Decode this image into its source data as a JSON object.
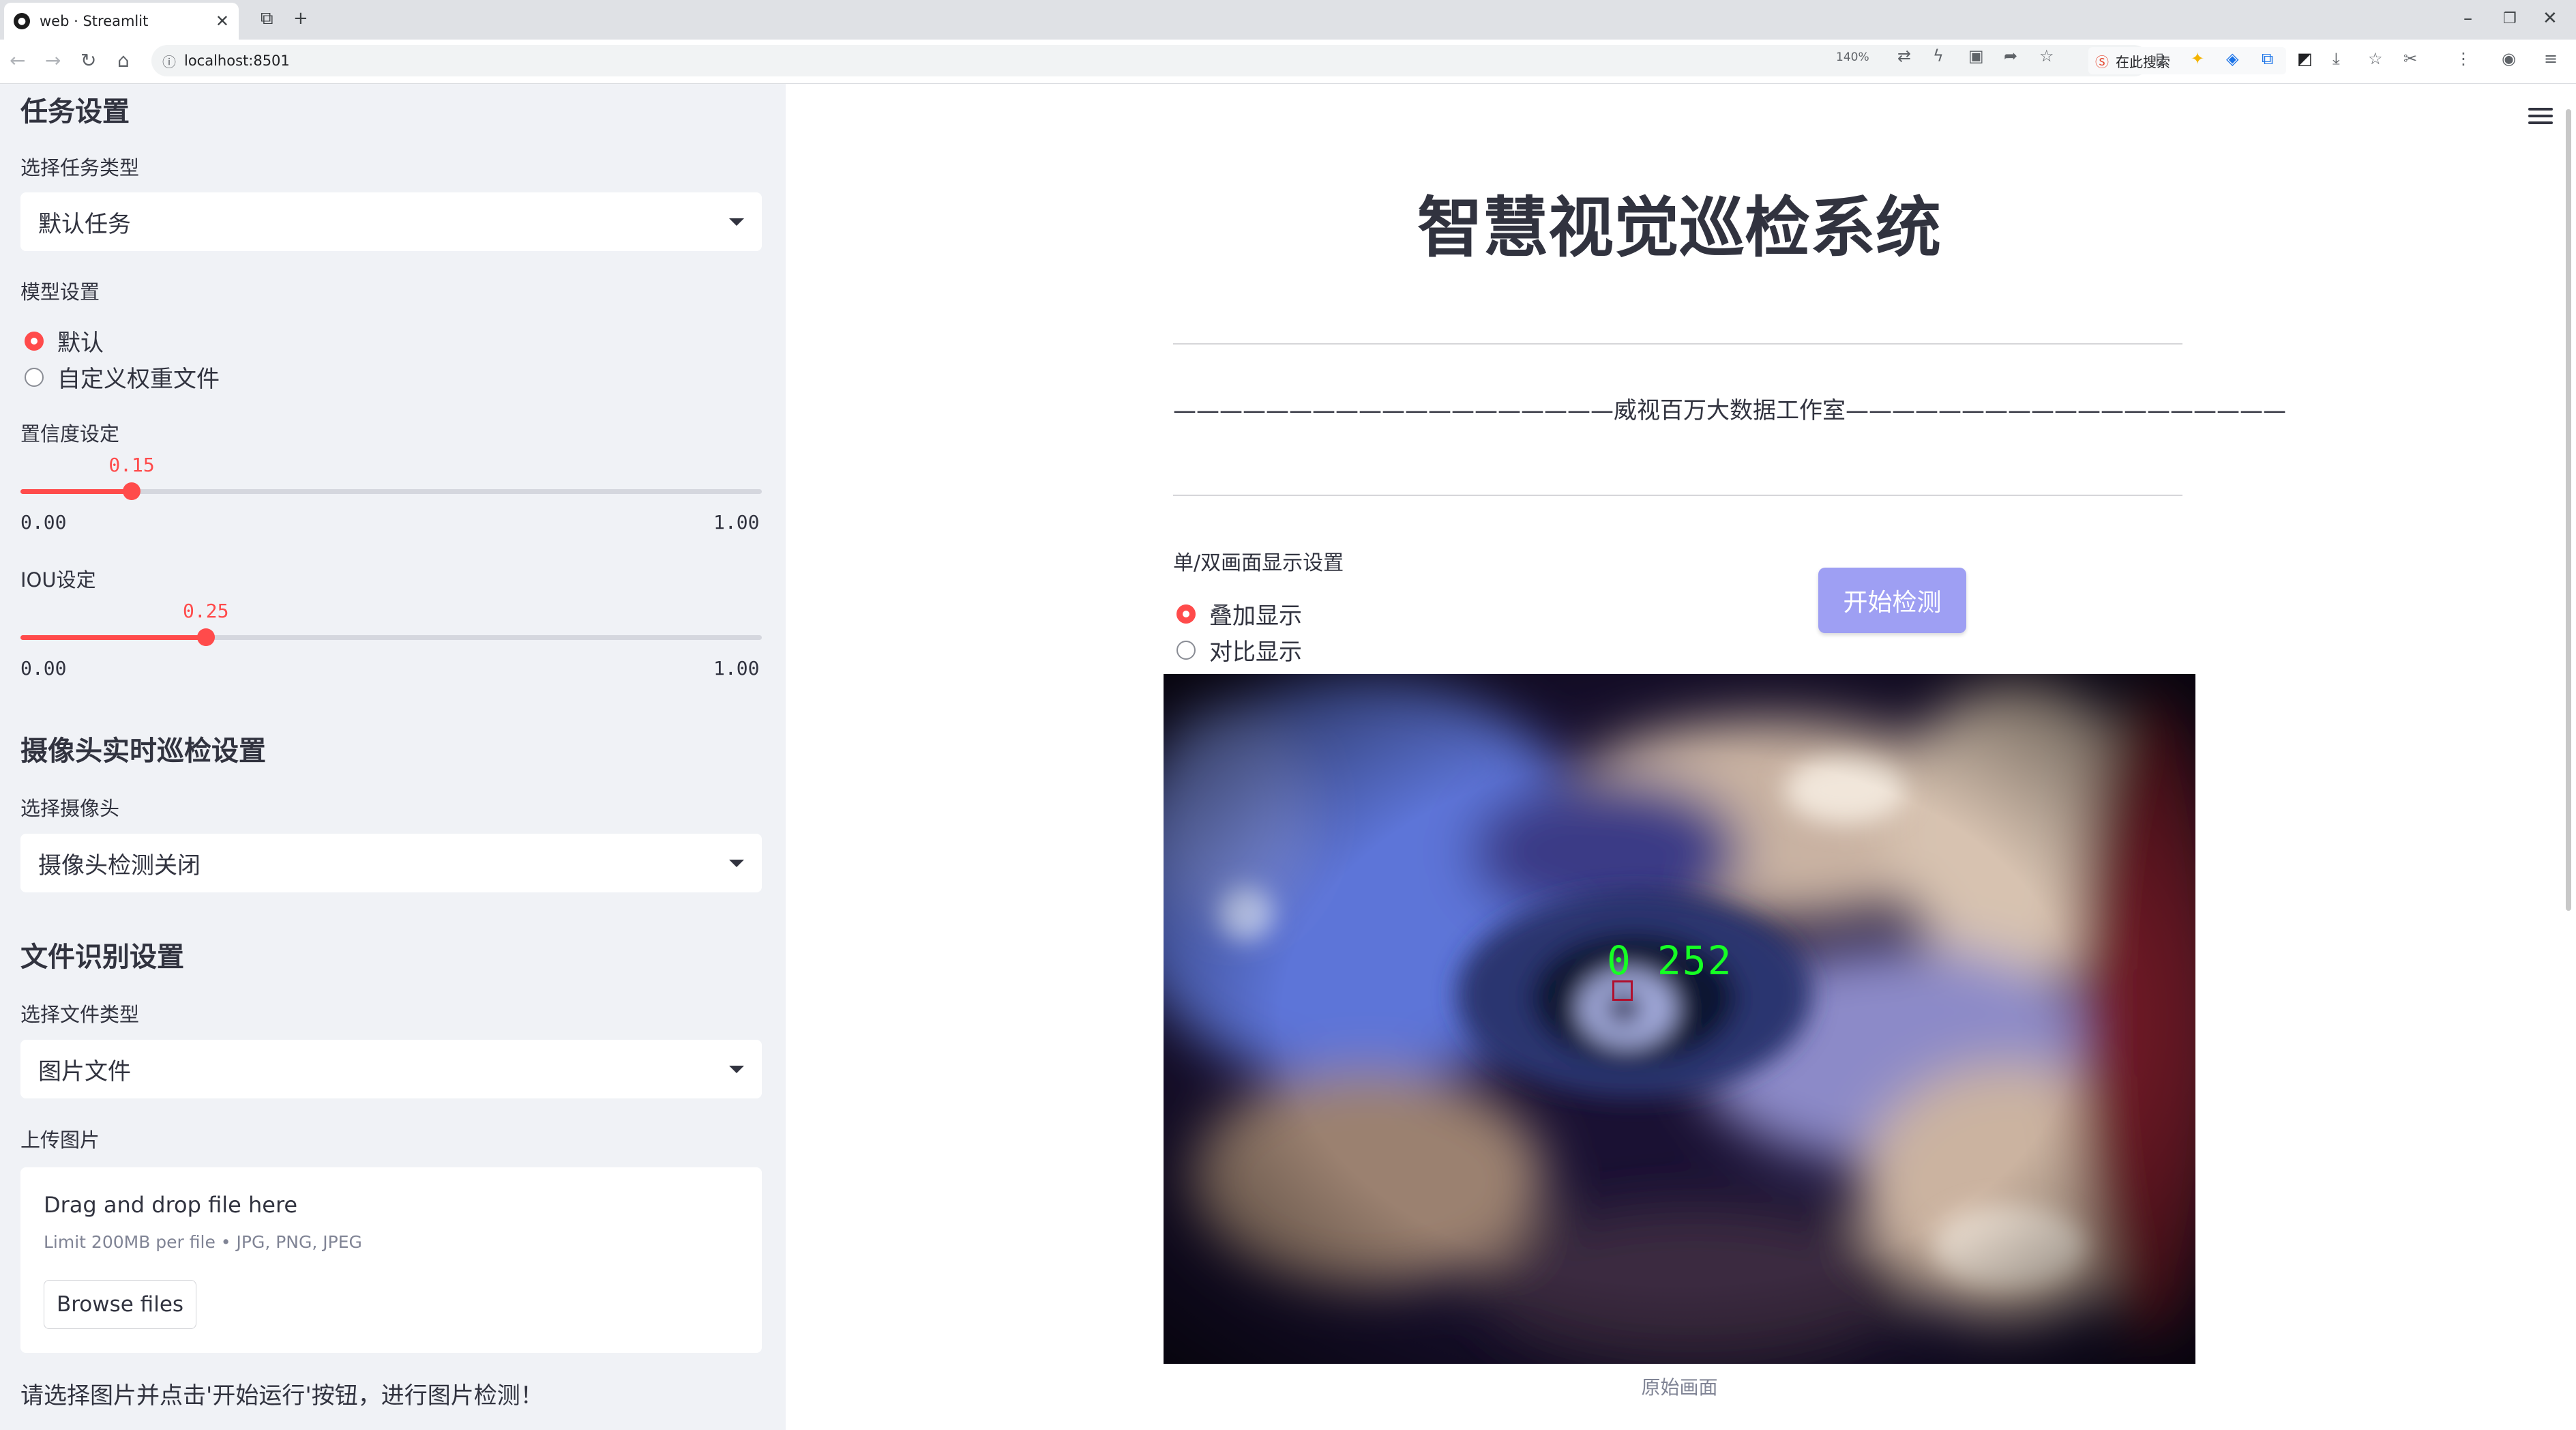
{
  "browser": {
    "tab_title": "web · Streamlit",
    "url": "localhost:8501",
    "zoom": "140%",
    "search_placeholder": "在此搜索"
  },
  "sidebar": {
    "task_section_title": "任务设置",
    "task_type_label": "选择任务类型",
    "task_type_value": "默认任务",
    "model_label": "模型设置",
    "model_options": [
      "默认",
      "自定义权重文件"
    ],
    "model_selected": "默认",
    "confidence_label": "置信度设定",
    "confidence_value": "0.15",
    "confidence_min": "0.00",
    "confidence_max": "1.00",
    "confidence_fraction": 0.15,
    "iou_label": "IOU设定",
    "iou_value": "0.25",
    "iou_min": "0.00",
    "iou_max": "1.00",
    "iou_fraction": 0.25,
    "camera_section_title": "摄像头实时巡检设置",
    "camera_label": "选择摄像头",
    "camera_value": "摄像头检测关闭",
    "file_section_title": "文件识别设置",
    "file_type_label": "选择文件类型",
    "file_type_value": "图片文件",
    "upload_label": "上传图片",
    "upload_drop_text": "Drag and drop file here",
    "upload_limit_text": "Limit 200MB per file • JPG, PNG, JPEG",
    "browse_button": "Browse files",
    "hint_text": "请选择图片并点击'开始运行'按钮，进行图片检测！"
  },
  "main": {
    "title": "智慧视觉巡检系统",
    "credit_line": "———————————————————威视百万大数据工作室———————————————————",
    "display_label": "单/双画面显示设置",
    "display_options": [
      "叠加显示",
      "对比显示"
    ],
    "display_selected": "叠加显示",
    "start_button": "开始检测",
    "detection_label": "0 252",
    "image_caption": "原始画面"
  },
  "colors": {
    "accent": "#ff4b4b",
    "sidebar_bg": "#f0f2f6",
    "button_bg": "#9e9ff3",
    "detection_text": "#16ff24",
    "detection_box": "#b0102e"
  }
}
